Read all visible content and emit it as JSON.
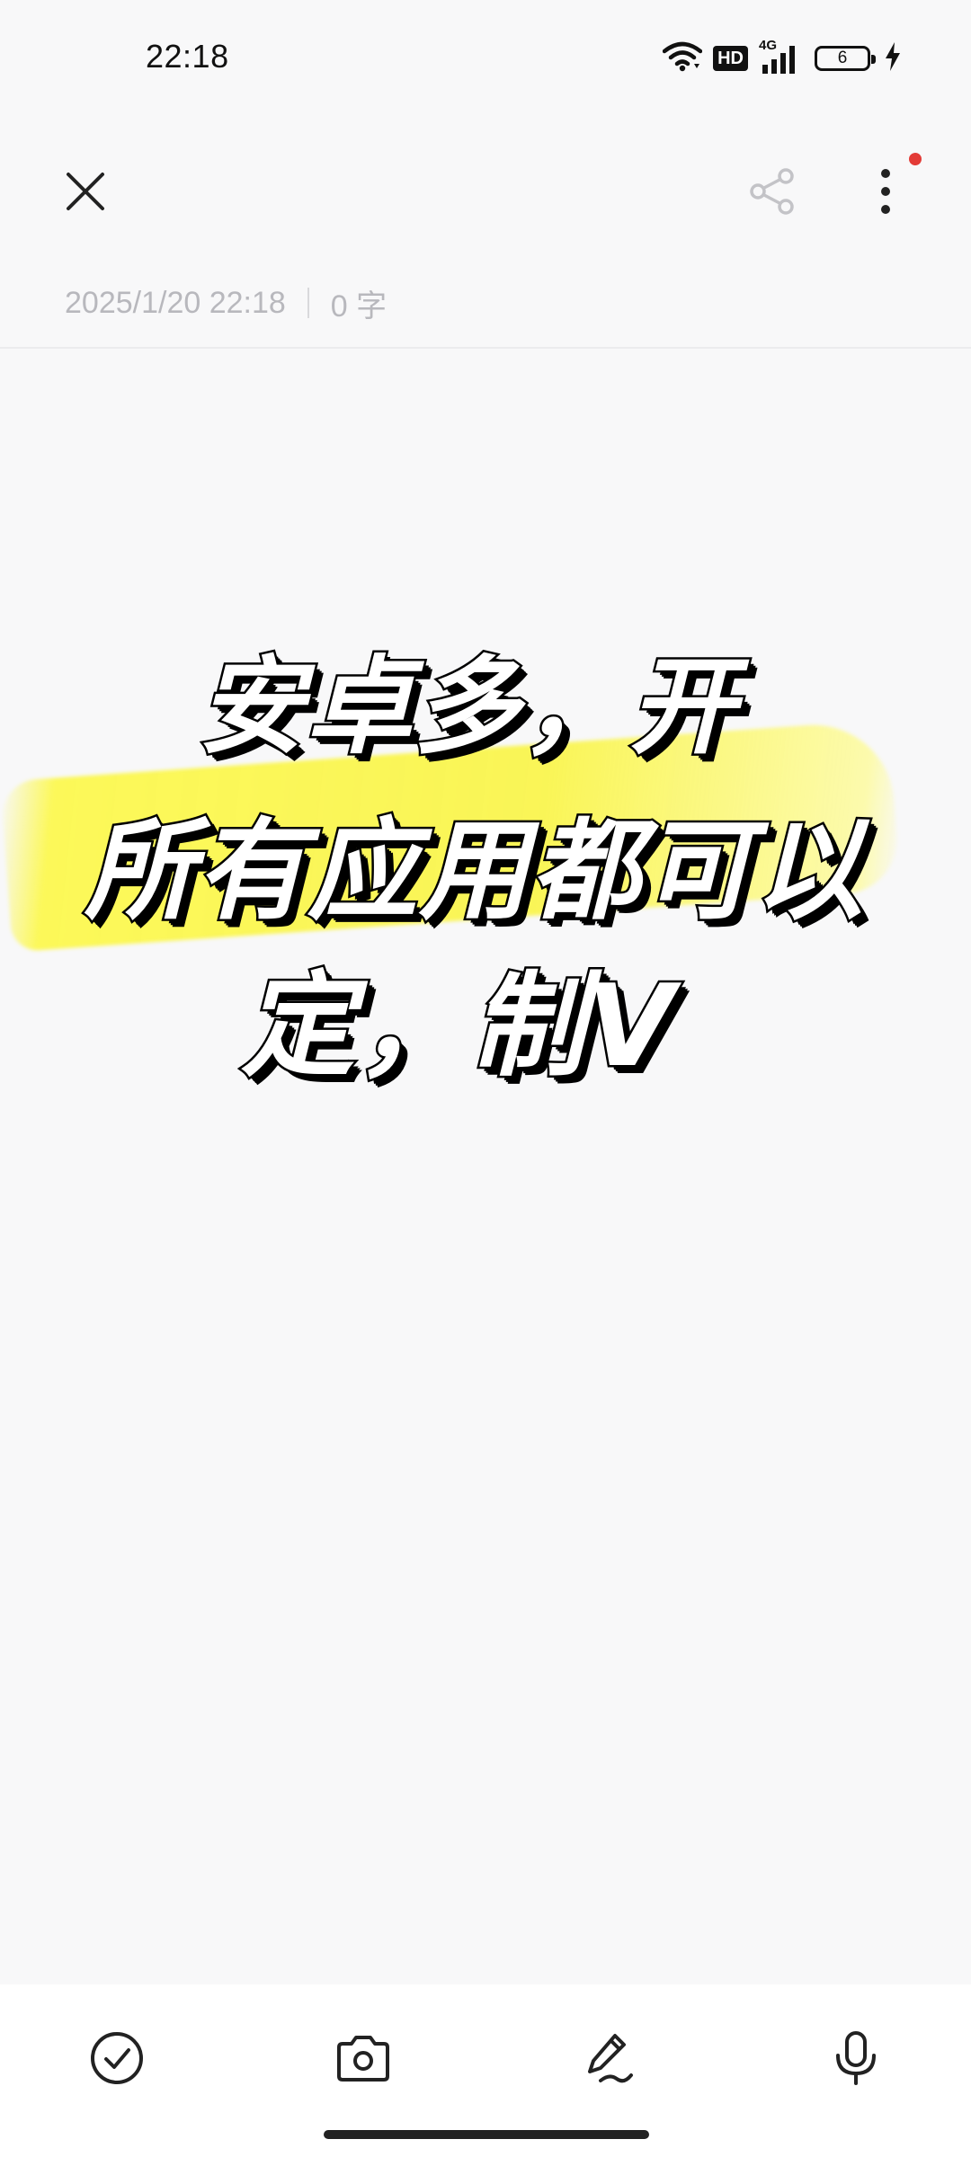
{
  "status_bar": {
    "time": "22:18",
    "hd": "HD",
    "network": "4G",
    "battery": "6",
    "icons": [
      "wifi-icon",
      "hd-icon",
      "signal-icon",
      "battery-icon",
      "charging-icon"
    ]
  },
  "toolbar": {
    "icons": [
      "close-icon",
      "share-icon",
      "more-icon"
    ],
    "notification_dot_color": "#e33b37"
  },
  "meta": {
    "timestamp": "2025/1/20 22:18",
    "word_count": "0 字"
  },
  "overlay": {
    "line1": "安卓多，开",
    "line2": "所有应用都可以",
    "line3": "定，制V",
    "highlight_color": "#fbf64f"
  },
  "bottom_toolbar": {
    "icons": [
      "checklist-icon",
      "camera-icon",
      "handwriting-icon",
      "microphone-icon"
    ]
  }
}
